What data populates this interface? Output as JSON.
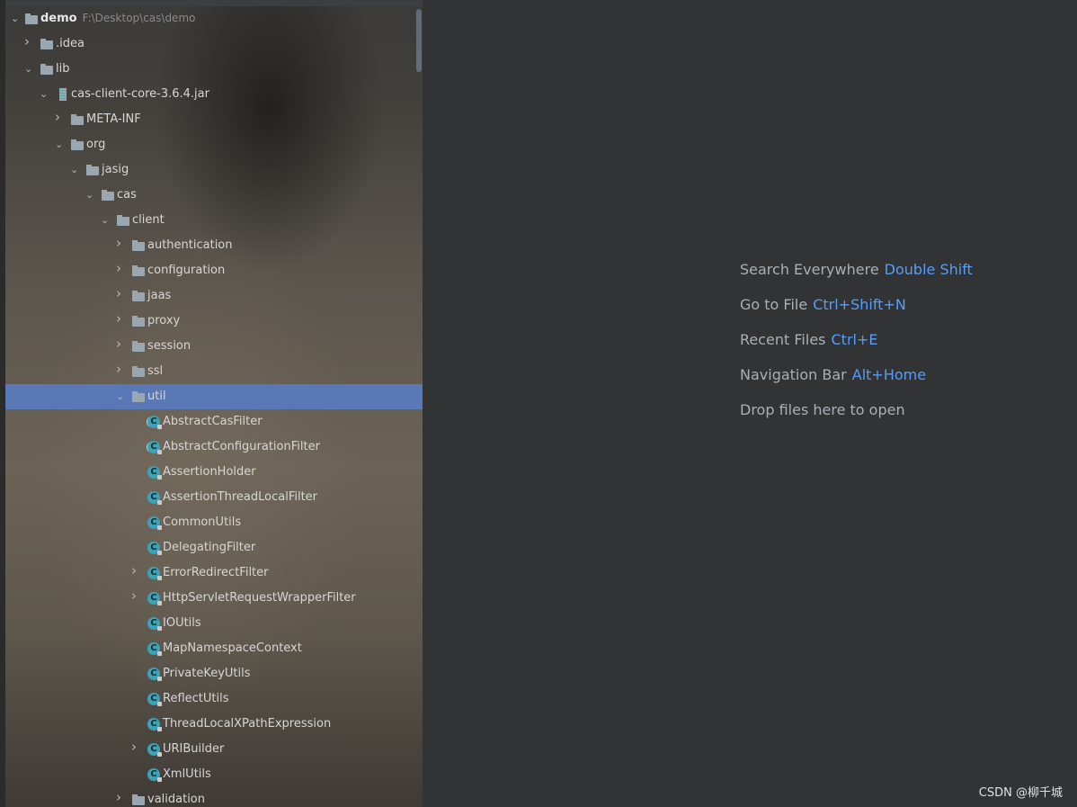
{
  "project_tree": {
    "root": {
      "label": "demo",
      "path": "F:\\Desktop\\cas\\demo"
    },
    "items": [
      {
        "label": ".idea",
        "level": 1,
        "type": "folder",
        "state": "collapsed"
      },
      {
        "label": "lib",
        "level": 1,
        "type": "folder",
        "state": "expanded"
      },
      {
        "label": "cas-client-core-3.6.4.jar",
        "level": 2,
        "type": "jar",
        "state": "expanded"
      },
      {
        "label": "META-INF",
        "level": 3,
        "type": "folder",
        "state": "collapsed"
      },
      {
        "label": "org",
        "level": 3,
        "type": "folder",
        "state": "expanded"
      },
      {
        "label": "jasig",
        "level": 4,
        "type": "folder",
        "state": "expanded"
      },
      {
        "label": "cas",
        "level": 5,
        "type": "folder",
        "state": "expanded"
      },
      {
        "label": "client",
        "level": 6,
        "type": "folder",
        "state": "expanded"
      },
      {
        "label": "authentication",
        "level": 7,
        "type": "folder",
        "state": "collapsed"
      },
      {
        "label": "configuration",
        "level": 7,
        "type": "folder",
        "state": "collapsed"
      },
      {
        "label": "jaas",
        "level": 7,
        "type": "folder",
        "state": "collapsed"
      },
      {
        "label": "proxy",
        "level": 7,
        "type": "folder",
        "state": "collapsed"
      },
      {
        "label": "session",
        "level": 7,
        "type": "folder",
        "state": "collapsed"
      },
      {
        "label": "ssl",
        "level": 7,
        "type": "folder",
        "state": "collapsed"
      },
      {
        "label": "util",
        "level": 7,
        "type": "folder",
        "state": "expanded",
        "selected": true
      },
      {
        "label": "AbstractCasFilter",
        "level": 8,
        "type": "abstract-class"
      },
      {
        "label": "AbstractConfigurationFilter",
        "level": 8,
        "type": "abstract-class"
      },
      {
        "label": "AssertionHolder",
        "level": 8,
        "type": "class"
      },
      {
        "label": "AssertionThreadLocalFilter",
        "level": 8,
        "type": "class"
      },
      {
        "label": "CommonUtils",
        "level": 8,
        "type": "class"
      },
      {
        "label": "DelegatingFilter",
        "level": 8,
        "type": "class"
      },
      {
        "label": "ErrorRedirectFilter",
        "level": 8,
        "type": "class",
        "state": "collapsed"
      },
      {
        "label": "HttpServletRequestWrapperFilter",
        "level": 8,
        "type": "class",
        "state": "collapsed"
      },
      {
        "label": "IOUtils",
        "level": 8,
        "type": "class"
      },
      {
        "label": "MapNamespaceContext",
        "level": 8,
        "type": "class"
      },
      {
        "label": "PrivateKeyUtils",
        "level": 8,
        "type": "class"
      },
      {
        "label": "ReflectUtils",
        "level": 8,
        "type": "class"
      },
      {
        "label": "ThreadLocalXPathExpression",
        "level": 8,
        "type": "class"
      },
      {
        "label": "URIBuilder",
        "level": 8,
        "type": "class",
        "state": "collapsed"
      },
      {
        "label": "XmlUtils",
        "level": 8,
        "type": "class"
      },
      {
        "label": "validation",
        "level": 7,
        "type": "folder",
        "state": "collapsed"
      }
    ]
  },
  "editor_hints": [
    {
      "action": "Search Everywhere",
      "shortcut": "Double Shift"
    },
    {
      "action": "Go to File",
      "shortcut": "Ctrl+Shift+N"
    },
    {
      "action": "Recent Files",
      "shortcut": "Ctrl+E"
    },
    {
      "action": "Navigation Bar",
      "shortcut": "Alt+Home"
    },
    {
      "action": "Drop files here to open",
      "shortcut": ""
    }
  ],
  "watermark": "CSDN @柳千城",
  "colors": {
    "accent": "#589df6",
    "selection": "#5b78b6",
    "editor_bg": "#313335",
    "class_icon": "#3ba2b8"
  }
}
